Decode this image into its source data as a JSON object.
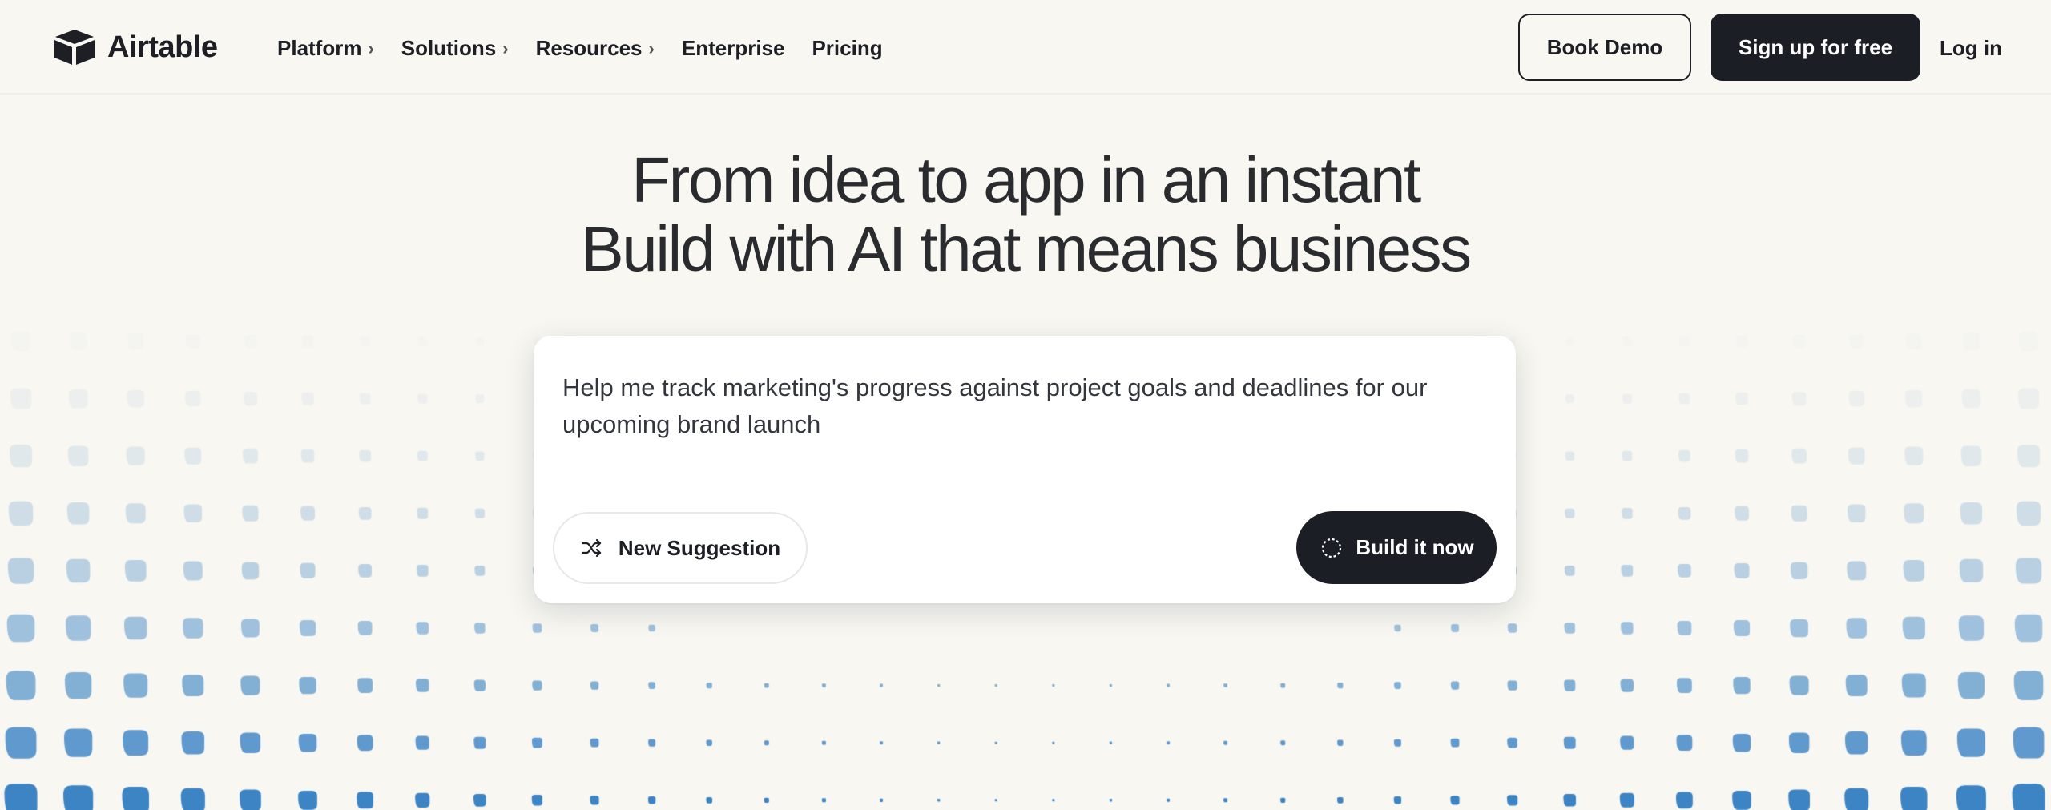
{
  "header": {
    "logo_text": "Airtable",
    "nav": [
      {
        "label": "Platform",
        "has_submenu": true
      },
      {
        "label": "Solutions",
        "has_submenu": true
      },
      {
        "label": "Resources",
        "has_submenu": true
      },
      {
        "label": "Enterprise",
        "has_submenu": false
      },
      {
        "label": "Pricing",
        "has_submenu": false
      }
    ],
    "book_demo_label": "Book Demo",
    "signup_label": "Sign up for free",
    "login_label": "Log in"
  },
  "hero": {
    "line1": "From idea to app in an instant",
    "line2": "Build with AI that means business"
  },
  "prompt": {
    "text": "Help me track marketing's progress against project goals and deadlines for our upcoming brand launch",
    "new_suggestion_label": "New Suggestion",
    "build_label": "Build it now"
  },
  "colors": {
    "background": "#f8f7f1",
    "dark": "#1b1e25",
    "dot_accent": "#3b82c4"
  },
  "icons": {
    "logo": "airtable-logo-icon",
    "chevron": "chevron-right-icon",
    "shuffle": "shuffle-icon",
    "build": "dashed-circle-icon"
  }
}
